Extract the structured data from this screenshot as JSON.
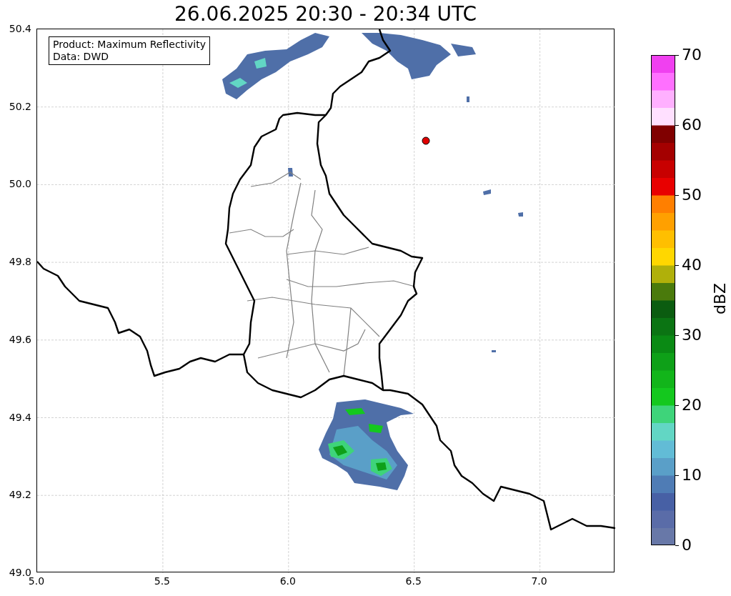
{
  "title": "26.06.2025 20:30 - 20:34 UTC",
  "map": {
    "legend": [
      "Product: Maximum Reflectivity",
      "Data: DWD"
    ],
    "xticks": [
      "5.0",
      "5.5",
      "6.0",
      "6.5",
      "7.0"
    ],
    "yticks": [
      "50.4",
      "50.2",
      "50.0",
      "49.8",
      "49.6",
      "49.4",
      "49.2",
      "49.0"
    ]
  },
  "colorbar": {
    "label": "dBZ",
    "ticks": [
      "70",
      "60",
      "50",
      "40",
      "30",
      "20",
      "10",
      "0"
    ]
  }
}
